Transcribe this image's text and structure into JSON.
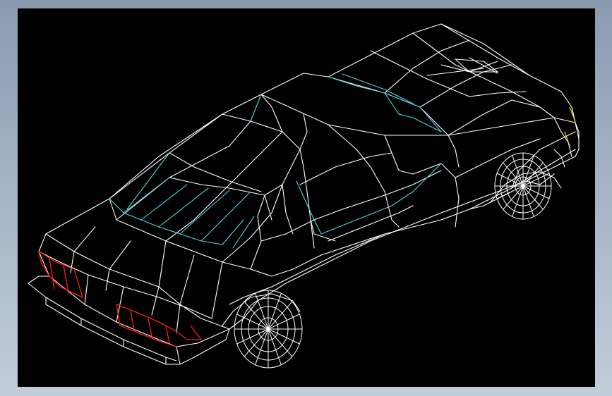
{
  "viewport": {
    "background": "#000000",
    "colors": {
      "body_lines": "#ffffff",
      "glass_lines": "#4fd8e0",
      "tail_lights": "#ff1a1a",
      "head_light": "#f5e000"
    }
  },
  "model": {
    "subject": "sedan-wireframe"
  }
}
